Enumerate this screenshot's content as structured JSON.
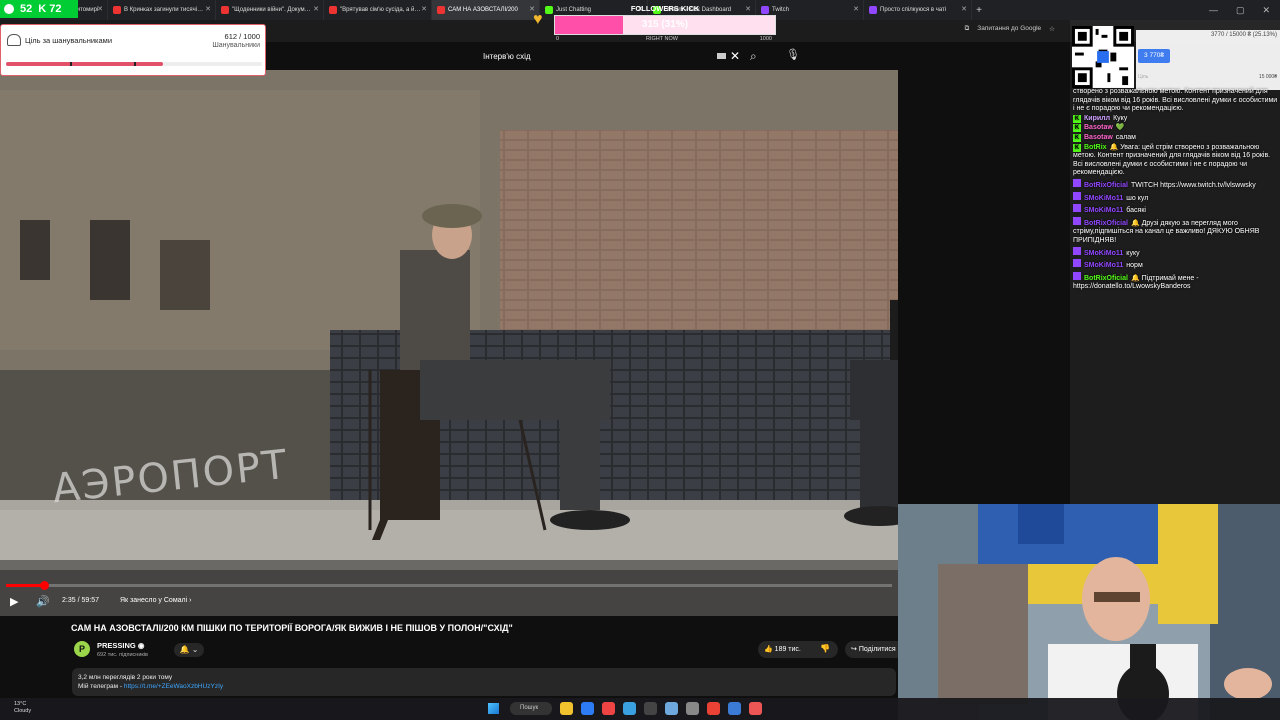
{
  "browser": {
    "tabs": [
      {
        "label": "Гонка з погромом в Житомирі",
        "color": "#c33"
      },
      {
        "label": "В Кринках загинули тисячі…",
        "color": "#e33"
      },
      {
        "label": "\"Щоденники війни\". Докум…",
        "color": "#e33"
      },
      {
        "label": "\"Врятував сім'ю сусіда, а й…",
        "color": "#e33"
      },
      {
        "label": "САМ НА АЗОВСТАЛІ/200",
        "color": "#e33"
      },
      {
        "label": "Just Chatting",
        "color": "#53fc18"
      },
      {
        "label": "Stream - Kick Dashboard",
        "color": "#53fc18"
      },
      {
        "label": "Twitch",
        "color": "#9146ff"
      },
      {
        "label": "Просто спілкуюся в чаті",
        "color": "#9146ff"
      }
    ],
    "active_tab": 4,
    "new_tab": "+",
    "bookmarks": [
      "Запитання до Google"
    ],
    "window_controls": [
      "—",
      "▢",
      "✕"
    ]
  },
  "overlay": {
    "kick_badge": "K 72",
    "kick_number": "52",
    "goal_title": "Ціль за шанувальниками",
    "goal_count": "612 / 1000",
    "goal_sub": "Шанувальники",
    "goal_progress": 0.612,
    "followers_title": "FOLLOWERS KICK",
    "followers_value": "315 (31%)",
    "followers_progress": 0.31,
    "followers_min": "0",
    "followers_mid": "RIGHT NOW",
    "followers_max": "1000"
  },
  "search": {
    "query": "Інтерв'ю схід",
    "clear": "✕"
  },
  "video": {
    "graffiti": "АЭРОПОРТ",
    "progress": 0.043,
    "time": "2:35 / 59:57",
    "chapter": "Як занесло у Сомалі",
    "title": "САМ НА АЗОВСТАЛІ/200 КМ ПІШКИ ПО ТЕРИТОРІЇ ВОРОГА/ЯК ВИЖИВ І НЕ ПІШОВ У ПОЛОН/\"СХІД\"",
    "channel": "PRESSING",
    "subscribers": "692 тис. підписників",
    "likes": "189 тис.",
    "share": "Поділитися",
    "views": "3,2 млн переглядів  2 роки тому",
    "telegram_label": "Мій телеграм - ",
    "telegram_link": "https://t.me/+ZEeWaoXzbHUzYzIy"
  },
  "donation": {
    "amount": "3770 / 15000 ₴ (25.13%)",
    "button": "3 770₴",
    "min": "Ціль",
    "max": "15 000₴"
  },
  "chat": [
    {
      "user": "",
      "text": "створено з розважальною метою. Контент призначений для глядачів віком від 16 років. Всі висловлені думки є особистими і не є порадою чи рекомендацією.",
      "color": "#fff",
      "icon": "none"
    },
    {
      "user": "Кирилл",
      "text": "Куку",
      "color": "#cfa0ff",
      "icon": "kick"
    },
    {
      "user": "Basotaw",
      "text": "💚",
      "color": "#ff66cc",
      "icon": "kick"
    },
    {
      "user": "Basotaw",
      "text": "салам",
      "color": "#ff66cc",
      "icon": "kick"
    },
    {
      "user": "BotRix",
      "text": "🔔 Увага: цей стрім створено з розважальною метою. Контент призначений для глядачів віком від 16 років. Всі висловлені думки є особистими і не є порадою чи рекомендацією.",
      "color": "#53fc18",
      "icon": "kick"
    },
    {
      "user": "BotRixOficial",
      "text": "TWITCH https://www.twitch.tv/lvlswwsky",
      "color": "#9146ff",
      "icon": "twitch"
    },
    {
      "user": "SMoKiMo11",
      "text": "шо кул",
      "color": "#9146ff",
      "icon": "twitch"
    },
    {
      "user": "SMoKiMo11",
      "text": "басякі",
      "color": "#9146ff",
      "icon": "twitch"
    },
    {
      "user": "BotRixOficial",
      "text": "🔔 Друзі дякую за перегляд мого стріму,підпишіться на канал це важливо! ДЯКУЮ ОБНЯВ ПРИПІДНЯВ!",
      "color": "#9146ff",
      "icon": "twitch"
    },
    {
      "user": "SMoKiMo11",
      "text": "куку",
      "color": "#9146ff",
      "icon": "twitch"
    },
    {
      "user": "SMoKiMo11",
      "text": "норм",
      "color": "#9146ff",
      "icon": "twitch"
    },
    {
      "user": "BotRixOficial",
      "text": "🔔 Підтримай мене - https://donatello.to/LwowskyBanderos",
      "color": "#53fc18",
      "icon": "twitch"
    }
  ],
  "taskbar": {
    "temp": "13°C",
    "weather": "Cloudy",
    "search": "Пошук",
    "apps": [
      "#f2c12e",
      "#2d7cf6",
      "#e44",
      "#3aa0e0",
      "#444",
      "#6fa8dc",
      "#888",
      "#ea4335",
      "#3b7bd6",
      "#e55"
    ]
  }
}
